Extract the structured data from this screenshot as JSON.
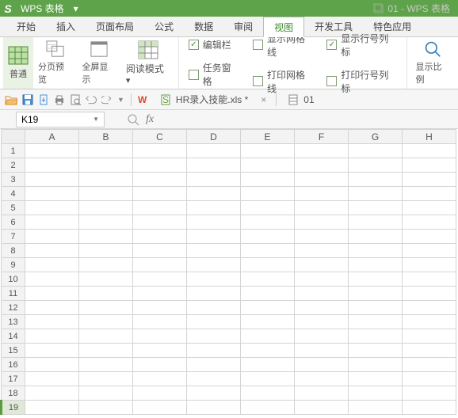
{
  "title": {
    "app": "WPS 表格",
    "doc": "01 - WPS 表格"
  },
  "menus": [
    "开始",
    "插入",
    "页面布局",
    "公式",
    "数据",
    "审阅",
    "视图",
    "开发工具",
    "特色应用"
  ],
  "menu_active": 6,
  "ribbon": {
    "views": [
      "普通",
      "分页预览",
      "全屏显示",
      "阅读模式"
    ],
    "checks1": [
      {
        "label": "编辑栏",
        "checked": true
      },
      {
        "label": "任务窗格",
        "checked": false
      }
    ],
    "checks2": [
      {
        "label": "显示网格线",
        "checked": false
      },
      {
        "label": "打印网格线",
        "checked": false
      }
    ],
    "checks3": [
      {
        "label": "显示行号列标",
        "checked": true
      },
      {
        "label": "打印行号列标",
        "checked": false
      }
    ],
    "zoom": "显示比例"
  },
  "qat": {
    "file": "HR录入技能.xls *",
    "tab2": "01"
  },
  "namebox": "K19",
  "cols": [
    "A",
    "B",
    "C",
    "D",
    "E",
    "F",
    "G",
    "H"
  ],
  "rows": [
    "1",
    "2",
    "3",
    "4",
    "5",
    "6",
    "7",
    "8",
    "9",
    "10",
    "11",
    "12",
    "13",
    "14",
    "15",
    "16",
    "17",
    "18",
    "19"
  ],
  "sel_row": 18
}
